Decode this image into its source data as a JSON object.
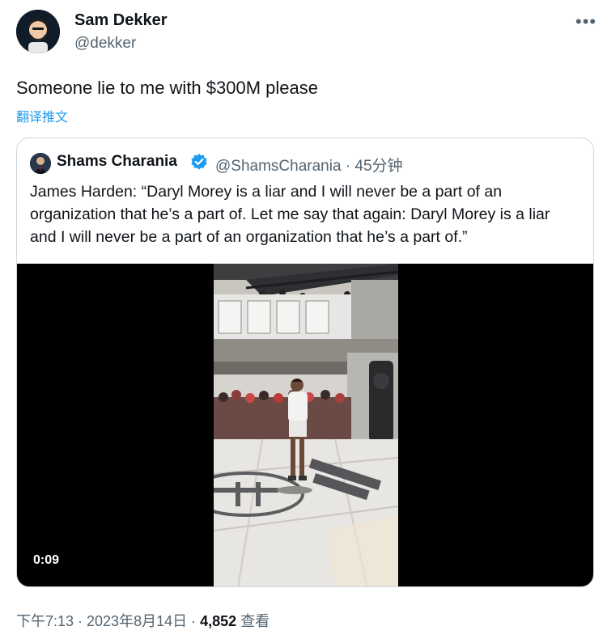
{
  "tweet": {
    "author_name": "Sam Dekker",
    "author_handle": "@dekker",
    "text": "Someone lie to me with $300M please",
    "translate_link": "翻译推文",
    "more_icon": "more-dots-icon"
  },
  "quote": {
    "author_name": "Shams Charania",
    "verified_icon": "verified-badge-icon",
    "meta": "@ShamsCharania · 45分钟",
    "text": "James Harden: “Daryl Morey is a liar and I will never be a part of an organization that he’s a part of. Let me say that again: Daryl Morey is a liar and I will never be a part of an organization that he’s a part of.”",
    "video": {
      "duration": "0:09"
    }
  },
  "footer": {
    "time": "下午7:13 · 2023年8月14日 · ",
    "views": "4,852",
    "views_label": "查看"
  },
  "colors": {
    "link": "#1d9bf0",
    "secondary": "#536471",
    "primary": "#0f1419"
  }
}
